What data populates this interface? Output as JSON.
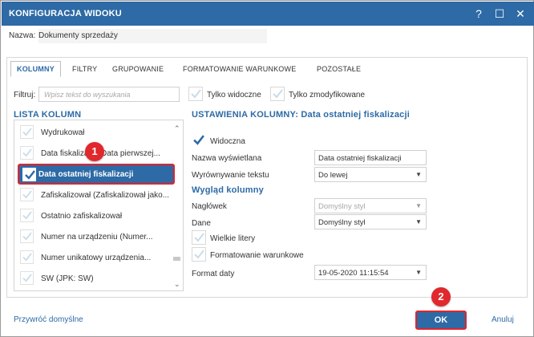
{
  "window": {
    "title": "KONFIGURACJA WIDOKU",
    "help": "?",
    "maximize": "☐",
    "close": "✕"
  },
  "name_row": {
    "label": "Nazwa:",
    "value": "Dokumenty sprzedaży"
  },
  "tabs": [
    {
      "label": "KOLUMNY",
      "active": true
    },
    {
      "label": "FILTRY"
    },
    {
      "label": "GRUPOWANIE"
    },
    {
      "label": "FORMATOWANIE WARUNKOWE"
    },
    {
      "label": "POZOSTAŁE"
    }
  ],
  "filter": {
    "label": "Filtruj:",
    "placeholder": "Wpisz tekst do wyszukania",
    "only_visible": "Tylko widoczne",
    "only_modified": "Tylko zmodyfikowane"
  },
  "column_list": {
    "title": "LISTA KOLUMN",
    "items": [
      {
        "label": "Wydrukował",
        "checked": false
      },
      {
        "label": "Data fiskalizacji (Data pierwszej...",
        "checked": false
      },
      {
        "label": "Data ostatniej fiskalizacji",
        "checked": true,
        "selected": true
      },
      {
        "label": "Zafiskalizował (Zafiskalizował jako...",
        "checked": false
      },
      {
        "label": "Ostatnio zafiskalizował",
        "checked": false
      },
      {
        "label": "Numer na urządzeniu (Numer...",
        "checked": false
      },
      {
        "label": "Numer unikatowy urządzenia...",
        "checked": false
      },
      {
        "label": "SW (JPK: SW)",
        "checked": false
      }
    ]
  },
  "badges": {
    "step1": "1",
    "step2": "2"
  },
  "settings": {
    "title": "USTAWIENIA KOLUMNY: Data ostatniej fiskalizacji",
    "visible_label": "Widoczna",
    "display_name_label": "Nazwa wyświetlana",
    "display_name_value": "Data ostatniej fiskalizacji",
    "alignment_label": "Wyrównywanie tekstu",
    "alignment_value": "Do lewej",
    "appearance_title": "Wygląd kolumny",
    "header_label": "Nagłówek",
    "header_value": "Domyślny styl",
    "data_label": "Dane",
    "data_value": "Domyślny styl",
    "uppercase_label": "Wielkie litery",
    "conditional_label": "Formatowanie warunkowe",
    "date_format_label": "Format daty",
    "date_format_value": "19-05-2020 11:15:54"
  },
  "footer": {
    "restore_defaults": "Przywróć domyślne",
    "ok": "OK",
    "cancel": "Anuluj"
  },
  "colors": {
    "accent": "#2d6aa6",
    "highlight_border": "#e1242a",
    "badge": "#e0282d"
  }
}
